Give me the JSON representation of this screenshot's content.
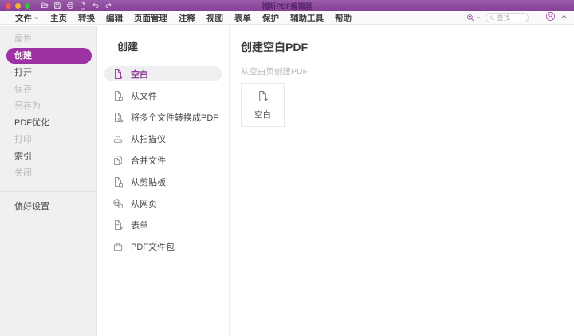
{
  "window": {
    "title": "福昕PDF编辑器"
  },
  "titlebar": {
    "icons": [
      "open-file-icon",
      "save-icon",
      "print-icon",
      "new-document-icon",
      "undo-icon",
      "redo-icon"
    ]
  },
  "menubar": {
    "items": [
      "文件",
      "主页",
      "转换",
      "编辑",
      "页面管理",
      "注释",
      "视图",
      "表单",
      "保护",
      "辅助工具",
      "帮助"
    ],
    "search": {
      "placeholder": "查找"
    },
    "overflow": "⋮"
  },
  "sidebar": {
    "items": [
      {
        "label": "属性",
        "state": "disabled"
      },
      {
        "label": "创建",
        "state": "selected"
      },
      {
        "label": "打开",
        "state": "normal"
      },
      {
        "label": "保存",
        "state": "disabled"
      },
      {
        "label": "另存为",
        "state": "disabled"
      },
      {
        "label": "PDF优化",
        "state": "normal"
      },
      {
        "label": "打印",
        "state": "disabled"
      },
      {
        "label": "索引",
        "state": "normal"
      },
      {
        "label": "关闭",
        "state": "disabled"
      }
    ],
    "footer": "偏好设置"
  },
  "create_panel": {
    "title": "创建",
    "items": [
      {
        "label": "空白",
        "icon": "blank-document-plus-icon",
        "selected": true
      },
      {
        "label": "从文件",
        "icon": "document-from-file-icon",
        "selected": false
      },
      {
        "label": "将多个文件转换成PDF",
        "icon": "multiple-files-to-pdf-icon",
        "selected": false
      },
      {
        "label": "从扫描仪",
        "icon": "scanner-icon",
        "selected": false
      },
      {
        "label": "合并文件",
        "icon": "combine-files-icon",
        "selected": false
      },
      {
        "label": "从剪贴板",
        "icon": "clipboard-icon",
        "selected": false
      },
      {
        "label": "从网页",
        "icon": "webpage-icon",
        "selected": false
      },
      {
        "label": "表单",
        "icon": "form-icon",
        "selected": false
      },
      {
        "label": "PDF文件包",
        "icon": "pdf-portfolio-icon",
        "selected": false
      }
    ]
  },
  "detail_panel": {
    "title": "创建空白PDF",
    "subtitle": "从空白页创建PDF",
    "card": {
      "label": "空白"
    }
  },
  "colors": {
    "titlebar": "#8b4a9b",
    "accent": "#9c32a4",
    "selected_text": "#8d3a96",
    "sidebar_bg": "#f1f0f1"
  }
}
